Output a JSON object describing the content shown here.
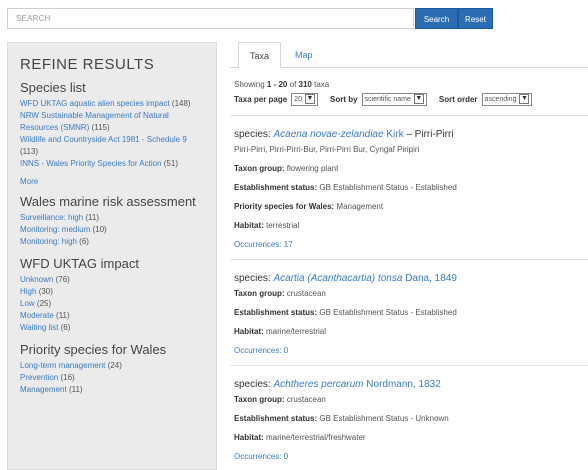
{
  "search": {
    "placeholder": "SEARCH",
    "search_label": "Search",
    "reset_label": "Reset"
  },
  "sidebar": {
    "title": "REFINE RESULTS",
    "sections": [
      {
        "title": "Species list",
        "items": [
          {
            "label": "WFD UKTAG aquatic alien species impact",
            "count": "(148)"
          },
          {
            "label": "NRW Sustainable Management of Natural Resources (SMNR)",
            "count": "(115)"
          },
          {
            "label": "Wildlife and Countryside Act 1981 - Schedule 9",
            "count": "(113)"
          },
          {
            "label": "INNS - Wales Priority Species for Action",
            "count": "(51)"
          }
        ],
        "more": "More"
      },
      {
        "title": "Wales marine risk assessment",
        "items": [
          {
            "label": "Surveillance: high",
            "count": "(11)"
          },
          {
            "label": "Monitoring: medium",
            "count": "(10)"
          },
          {
            "label": "Monitoring: high",
            "count": "(6)"
          }
        ]
      },
      {
        "title": "WFD UKTAG impact",
        "items": [
          {
            "label": "Unknown",
            "count": "(76)"
          },
          {
            "label": "High",
            "count": "(30)"
          },
          {
            "label": "Low",
            "count": "(25)"
          },
          {
            "label": "Moderate",
            "count": "(11)"
          },
          {
            "label": "Waiting list",
            "count": "(6)"
          }
        ]
      },
      {
        "title": "Priority species for Wales",
        "items": [
          {
            "label": "Long-term management",
            "count": "(24)"
          },
          {
            "label": "Prevention",
            "count": "(16)"
          },
          {
            "label": "Management",
            "count": "(11)"
          }
        ]
      }
    ]
  },
  "tabs": [
    {
      "label": "Taxa"
    },
    {
      "label": "Map"
    }
  ],
  "summary": {
    "prefix": "Showing ",
    "range": "1 - 20",
    "of": " of ",
    "total": "310",
    "suffix": " taxa"
  },
  "controls": {
    "per_page_label": "Taxa per page",
    "per_page_value": "20",
    "sort_by_label": "Sort by",
    "sort_by_value": "scientific name",
    "sort_order_label": "Sort order",
    "sort_order_value": "ascending"
  },
  "results": [
    {
      "prefix": "species: ",
      "scientific": "Acaena novae-zelandiae",
      "author": " Kirk",
      "common": " – Pirri-Pirri",
      "names": "Pirri-Pirri, Pirri-Pirri-Bur, Pirri-Pirri Bur, Cyngaf Piripiri",
      "taxon_group_label": "Taxon group:",
      "taxon_group": " flowering plant",
      "status_label": "Establishment status:",
      "status": " GB Establishment Status - Established",
      "priority_label": "Priority species for Wales:",
      "priority": " Management",
      "habitat_label": "Habitat:",
      "habitat": " terrestrial",
      "occurrences": "Occurrences: 17"
    },
    {
      "prefix": "species: ",
      "scientific": "Acartia (Acanthacartia) tonsa",
      "author": " Dana, 1849",
      "taxon_group_label": "Taxon group:",
      "taxon_group": " crustacean",
      "status_label": "Establishment status:",
      "status": " GB Establishment Status - Established",
      "habitat_label": "Habitat:",
      "habitat": " marine/terrestrial",
      "occurrences": "Occurrences: 0"
    },
    {
      "prefix": "species: ",
      "scientific": "Achtheres percarum",
      "author": " Nordmann, 1832",
      "taxon_group_label": "Taxon group:",
      "taxon_group": " crustacean",
      "status_label": "Establishment status:",
      "status": " GB Establishment Status - Unknown",
      "habitat_label": "Habitat:",
      "habitat": " marine/terrestrial/freshwater",
      "occurrences": "Occurrences: 0"
    }
  ]
}
